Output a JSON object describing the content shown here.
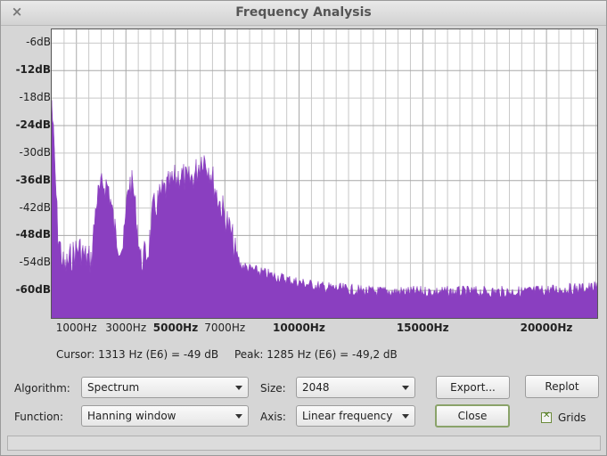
{
  "window": {
    "title": "Frequency Analysis",
    "close_glyph": "×"
  },
  "chart_data": {
    "type": "area",
    "xlim": [
      0,
      22050
    ],
    "ylim": [
      -66,
      -3
    ],
    "grid": true,
    "x_ticks": [
      {
        "value": 1000,
        "label": "1000Hz",
        "major": false
      },
      {
        "value": 3000,
        "label": "3000Hz",
        "major": false
      },
      {
        "value": 5000,
        "label": "5000Hz",
        "major": true
      },
      {
        "value": 7000,
        "label": "7000Hz",
        "major": false
      },
      {
        "value": 10000,
        "label": "10000Hz",
        "major": true
      },
      {
        "value": 15000,
        "label": "15000Hz",
        "major": true
      },
      {
        "value": 20000,
        "label": "20000Hz",
        "major": true
      }
    ],
    "y_ticks": [
      {
        "value": -6,
        "label": "-6dB",
        "major": false
      },
      {
        "value": -12,
        "label": "-12dB",
        "major": true
      },
      {
        "value": -18,
        "label": "-18dB",
        "major": false
      },
      {
        "value": -24,
        "label": "-24dB",
        "major": true
      },
      {
        "value": -30,
        "label": "-30dB",
        "major": false
      },
      {
        "value": -36,
        "label": "-36dB",
        "major": true
      },
      {
        "value": -42,
        "label": "-42dB",
        "major": false
      },
      {
        "value": -48,
        "label": "-48dB",
        "major": true
      },
      {
        "value": -54,
        "label": "-54dB",
        "major": false
      },
      {
        "value": -60,
        "label": "-60dB",
        "major": true
      }
    ],
    "fill_color": "#8a3fc0",
    "grid_color": "#c8c8c8",
    "envelope": [
      {
        "x": 0,
        "y": -15
      },
      {
        "x": 100,
        "y": -26
      },
      {
        "x": 250,
        "y": -44
      },
      {
        "x": 500,
        "y": -52
      },
      {
        "x": 800,
        "y": -49
      },
      {
        "x": 1100,
        "y": -47
      },
      {
        "x": 1313,
        "y": -49
      },
      {
        "x": 1600,
        "y": -50
      },
      {
        "x": 1800,
        "y": -37
      },
      {
        "x": 2100,
        "y": -33
      },
      {
        "x": 2300,
        "y": -34
      },
      {
        "x": 2600,
        "y": -45
      },
      {
        "x": 2900,
        "y": -47
      },
      {
        "x": 3100,
        "y": -33
      },
      {
        "x": 3300,
        "y": -34
      },
      {
        "x": 3600,
        "y": -50
      },
      {
        "x": 3900,
        "y": -48
      },
      {
        "x": 4100,
        "y": -39
      },
      {
        "x": 4500,
        "y": -35
      },
      {
        "x": 4900,
        "y": -33
      },
      {
        "x": 5200,
        "y": -31
      },
      {
        "x": 5500,
        "y": -33
      },
      {
        "x": 5800,
        "y": -31
      },
      {
        "x": 6100,
        "y": -27
      },
      {
        "x": 6400,
        "y": -30
      },
      {
        "x": 6700,
        "y": -36
      },
      {
        "x": 7000,
        "y": -40
      },
      {
        "x": 7300,
        "y": -45
      },
      {
        "x": 7600,
        "y": -53
      },
      {
        "x": 8000,
        "y": -54
      },
      {
        "x": 8600,
        "y": -55
      },
      {
        "x": 9300,
        "y": -56
      },
      {
        "x": 10000,
        "y": -57
      },
      {
        "x": 11000,
        "y": -58
      },
      {
        "x": 13000,
        "y": -59
      },
      {
        "x": 16000,
        "y": -59
      },
      {
        "x": 19000,
        "y": -59
      },
      {
        "x": 22050,
        "y": -58
      }
    ]
  },
  "readout": {
    "cursor": "Cursor: 1313 Hz (E6) = -49 dB",
    "peak": "Peak: 1285 Hz (E6) = -49,2 dB"
  },
  "controls": {
    "algorithm_label": "Algorithm:",
    "algorithm_value": "Spectrum",
    "function_label": "Function:",
    "function_value": "Hanning window",
    "size_label": "Size:",
    "size_value": "2048",
    "axis_label": "Axis:",
    "axis_value": "Linear frequency",
    "export_label": "Export...",
    "replot_label": "Replot",
    "close_label": "Close",
    "grids_label": "Grids",
    "grids_checked": true
  }
}
